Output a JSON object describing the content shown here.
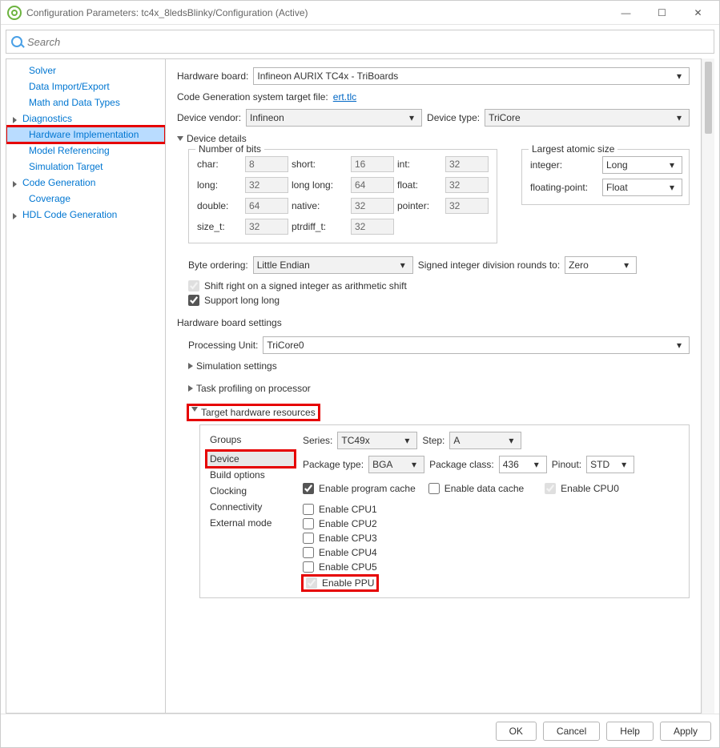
{
  "window": {
    "title": "Configuration Parameters: tc4x_8ledsBlinky/Configuration (Active)"
  },
  "search": {
    "placeholder": "Search"
  },
  "sidebar": {
    "items": [
      {
        "label": "Solver",
        "parent": false
      },
      {
        "label": "Data Import/Export",
        "parent": false
      },
      {
        "label": "Math and Data Types",
        "parent": false
      },
      {
        "label": "Diagnostics",
        "parent": true
      },
      {
        "label": "Hardware Implementation",
        "parent": false,
        "selected": true,
        "highlight": true
      },
      {
        "label": "Model Referencing",
        "parent": false
      },
      {
        "label": "Simulation Target",
        "parent": false
      },
      {
        "label": "Code Generation",
        "parent": true
      },
      {
        "label": "Coverage",
        "parent": false
      },
      {
        "label": "HDL Code Generation",
        "parent": true
      }
    ]
  },
  "main": {
    "hwboard_lbl": "Hardware board:",
    "hwboard_val": "Infineon AURIX TC4x - TriBoards",
    "codegen_lbl": "Code Generation system target file:",
    "codegen_link": "ert.tlc",
    "vendor_lbl": "Device vendor:",
    "vendor_val": "Infineon",
    "devtype_lbl": "Device type:",
    "devtype_val": "TriCore",
    "devdetails": "Device details",
    "bits": {
      "title": "Number of bits",
      "char_l": "char:",
      "char_v": "8",
      "short_l": "short:",
      "short_v": "16",
      "int_l": "int:",
      "int_v": "32",
      "long_l": "long:",
      "long_v": "32",
      "longlong_l": "long long:",
      "longlong_v": "64",
      "float_l": "float:",
      "float_v": "32",
      "double_l": "double:",
      "double_v": "64",
      "native_l": "native:",
      "native_v": "32",
      "pointer_l": "pointer:",
      "pointer_v": "32",
      "sizet_l": "size_t:",
      "sizet_v": "32",
      "ptrdiff_l": "ptrdiff_t:",
      "ptrdiff_v": "32"
    },
    "atomic": {
      "title": "Largest atomic size",
      "int_l": "integer:",
      "int_v": "Long",
      "fp_l": "floating-point:",
      "fp_v": "Float"
    },
    "byteorder_lbl": "Byte ordering:",
    "byteorder_val": "Little Endian",
    "signed_div_lbl": "Signed integer division rounds to:",
    "signed_div_val": "Zero",
    "shift_right": "Shift right on a signed integer as arithmetic shift",
    "support_ll": "Support long long",
    "hw_settings": "Hardware board settings",
    "procunit_lbl": "Processing Unit:",
    "procunit_val": "TriCore0",
    "sim_settings": "Simulation settings",
    "task_prof": "Task profiling on processor",
    "thr": "Target hardware resources",
    "groups": {
      "caption": "Groups",
      "items": [
        "Device",
        "Build options",
        "Clocking",
        "Connectivity",
        "External mode"
      ]
    },
    "device": {
      "series_l": "Series:",
      "series_v": "TC49x",
      "step_l": "Step:",
      "step_v": "A",
      "pkgtype_l": "Package type:",
      "pkgtype_v": "BGA",
      "pkgclass_l": "Package class:",
      "pkgclass_v": "436",
      "pinout_l": "Pinout:",
      "pinout_v": "STD",
      "en_prog_cache": "Enable program cache",
      "en_data_cache": "Enable data cache",
      "en_cpu0": "Enable CPU0",
      "en_cpu1": "Enable CPU1",
      "en_cpu2": "Enable CPU2",
      "en_cpu3": "Enable CPU3",
      "en_cpu4": "Enable CPU4",
      "en_cpu5": "Enable CPU5",
      "en_ppu": "Enable PPU"
    }
  },
  "footer": {
    "ok": "OK",
    "cancel": "Cancel",
    "help": "Help",
    "apply": "Apply"
  }
}
